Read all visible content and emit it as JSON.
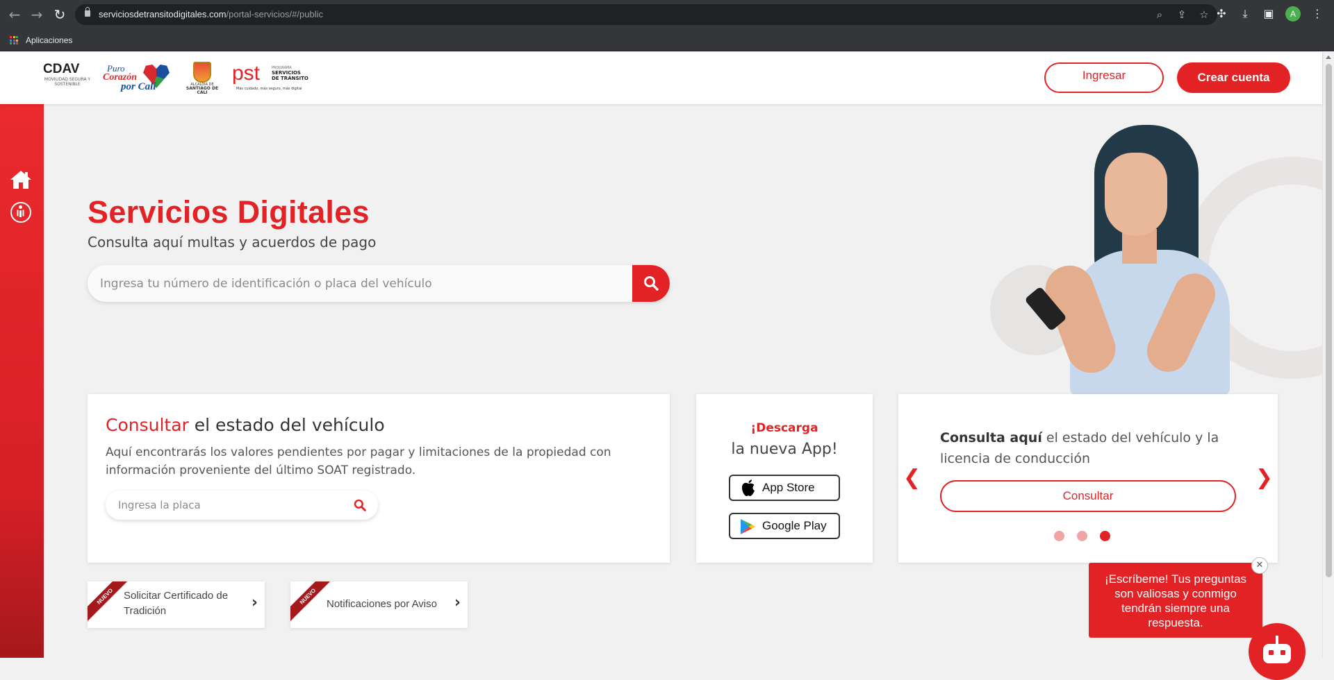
{
  "browser": {
    "url_domain": "serviciosdetransitodigitales.com",
    "url_path": "/portal-servicios/#/public",
    "bookmark_apps_label": "Aplicaciones",
    "profile_initial": "A"
  },
  "header": {
    "logos": {
      "cdav_mark": "CDAV",
      "cdav_sub": "MOVILIDAD SEGURA Y SOSTENIBLE",
      "cali_line1": "Puro",
      "cali_line2": "Corazón",
      "cali_line3": "por Cali",
      "alcaldia_line1": "ALCALDÍA DE",
      "alcaldia_line2": "SANTIAGO DE CALI",
      "pst_mark": "pst",
      "pst_small": "PROGRAMA",
      "pst_big": "SERVICIOS DE TRÁNSITO",
      "pst_tagline": "Más cuidado, más seguro, más digital"
    },
    "login_label": "Ingresar",
    "register_label": "Crear cuenta"
  },
  "hero": {
    "title": "Servicios Digitales",
    "subtitle": "Consulta aquí multas y acuerdos de pago",
    "search_placeholder": "Ingresa tu número de identificación o placa del vehículo"
  },
  "vehicle_card": {
    "title_highlight": "Consultar",
    "title_rest": " el estado del vehículo",
    "description": "Aquí encontrarás los valores pendientes por pagar y limitaciones de la propiedad con información proveniente del último SOAT registrado.",
    "plate_placeholder": "Ingresa la placa"
  },
  "app_card": {
    "line1": "¡Descarga",
    "line2": "la nueva App!",
    "app_store_label": "App Store",
    "google_play_label": "Google Play"
  },
  "carousel": {
    "message_bold": "Consulta aquí",
    "message_rest": " el estado del vehículo y la licencia de conducción",
    "button_label": "Consultar",
    "prev_symbol": "❮",
    "next_symbol": "❯",
    "slide_count": 3,
    "active_slide": 3
  },
  "tiles": [
    {
      "badge": "NUEVO",
      "label": "Solicitar Certificado de Tradición"
    },
    {
      "badge": "NUEVO",
      "label": "Notificaciones por Aviso"
    }
  ],
  "chat": {
    "message": "¡Escríbeme! Tus preguntas son valiosas y conmigo tendrán siempre una respuesta.",
    "close_symbol": "✕"
  },
  "colors": {
    "brand_red": "#e32226",
    "dark_red": "#a5181c",
    "background": "#f1f1f1"
  }
}
